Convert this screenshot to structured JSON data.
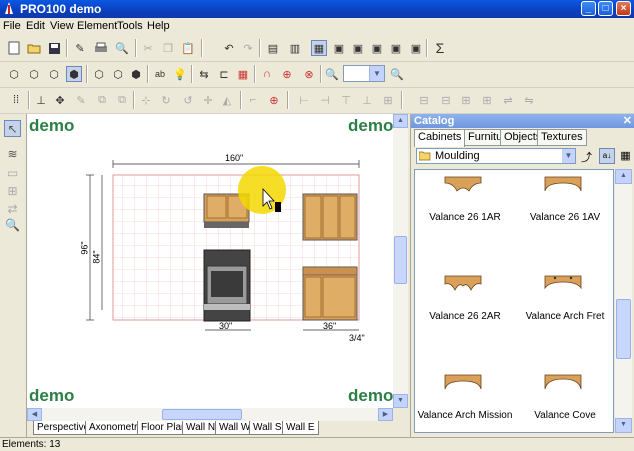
{
  "window": {
    "title": "PRO100 demo"
  },
  "menu": [
    "File",
    "Edit",
    "View",
    "Element",
    "Tools",
    "Help"
  ],
  "toolbar": {
    "zoom_value": ""
  },
  "view": {
    "watermark": "demo",
    "dims": {
      "width": "160\"",
      "height_outer": "96\"",
      "height_inner": "84\"",
      "stove": "30\"",
      "base": "36\"",
      "corner": "3/4\""
    }
  },
  "view_tabs": [
    "Perspective",
    "Axonometry",
    "Floor Plan",
    "Wall N",
    "Wall W",
    "Wall S",
    "Wall E"
  ],
  "status": {
    "text": "Elements: 13"
  },
  "catalog": {
    "title": "Catalog",
    "tabs": [
      "Cabinets",
      "Furniture",
      "Objects",
      "Textures"
    ],
    "folder": "Moulding",
    "items": [
      {
        "label": "Valance 26 1AR"
      },
      {
        "label": "Valance 26 1AV"
      },
      {
        "label": "Valance 26 2AR"
      },
      {
        "label": "Valance Arch Fret"
      },
      {
        "label": "Valance Arch Mission"
      },
      {
        "label": "Valance Cove"
      }
    ]
  },
  "colors": {
    "accent": "#0a3fbe",
    "wood": "#d9a05a",
    "watermark": "#2c7f45",
    "grid": "#f0a0a0"
  }
}
